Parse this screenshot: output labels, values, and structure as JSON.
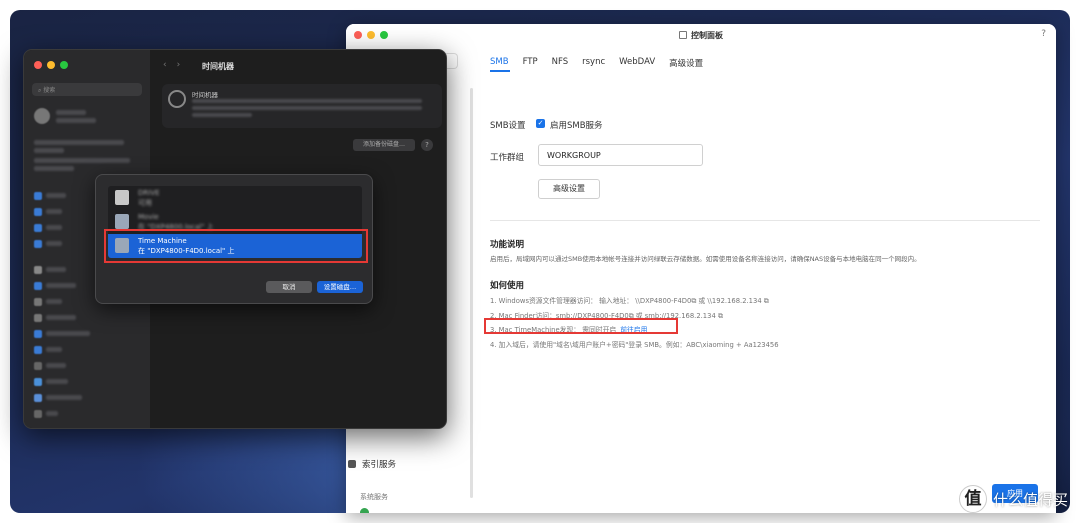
{
  "control_panel": {
    "title": "控制面板",
    "help": "?",
    "tabs": [
      "SMB",
      "FTP",
      "NFS",
      "rsync",
      "WebDAV",
      "高级设置"
    ],
    "smb_setting_label": "SMB设置",
    "enable_smb_label": "启用SMB服务",
    "enable_smb_checked": true,
    "workgroup_label": "工作群组",
    "workgroup_value": "WORKGROUP",
    "advanced_button": "高级设置",
    "feature_title": "功能说明",
    "feature_desc": "启用后，局域网内可以通过SMB使用本地帐号连接并访问绿联云存储数据。如需使用设备名称连接访问，请确保NAS设备与本地电脑在同一个网段内。",
    "howto_title": "如何使用",
    "steps": [
      "1. Windows资源文件管理器访问： 输入地址： \\\\DXP4800-F4D0⧉  或  \\\\192.168.2.134 ⧉",
      "2. Mac Finder访问：smb://DXP4800-F4D0⧉  或  smb://192.168.2.134 ⧉",
      "3. Mac TimeMachine发现： 需同时开启",
      "4. 加入域后，请使用\"域名\\域用户账户+密码\"登录 SMB。例如：ABC\\xiaoming + Aa123456"
    ],
    "step3_link": "前往启用",
    "sidebar_index_service": "索引服务",
    "sidebar_system_services": "系统服务",
    "apply_button": "应用",
    "accent": "#1a73e8"
  },
  "mac_settings": {
    "search_placeholder": "搜索",
    "pane_title": "时间机器",
    "add_backup_disk": "添加备份磁盘…",
    "help": "?"
  },
  "dialog": {
    "disks": [
      {
        "name": "DRIVE",
        "sub": "可用",
        "blurred": true
      },
      {
        "name": "Movie",
        "sub": "在 \"DXP4800.local\" 上",
        "blurred": true
      },
      {
        "name": "Time Machine",
        "sub": "在 \"DXP4800-F4D0.local\" 上",
        "blurred": false
      }
    ],
    "cancel_button": "取消",
    "setup_button": "设置磁盘…",
    "selected_color": "#1b63d6"
  },
  "watermark": {
    "logo_glyph": "值",
    "text": "什么值得买"
  }
}
